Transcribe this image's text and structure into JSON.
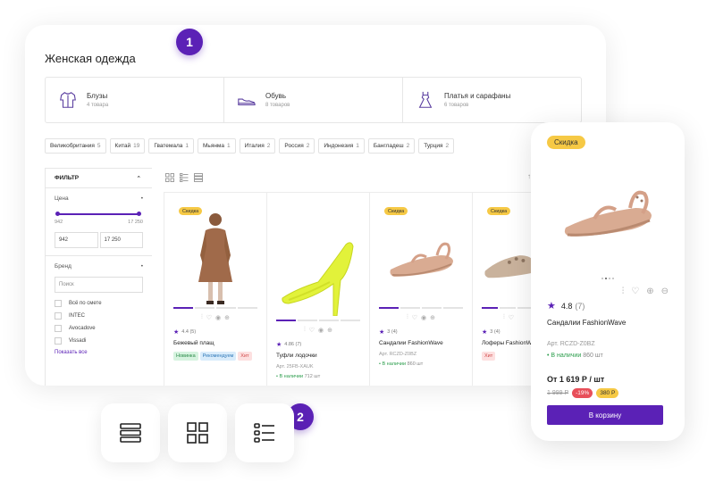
{
  "badges": {
    "first": "1",
    "second": "2"
  },
  "page": {
    "title": "Женская одежда"
  },
  "categories": [
    {
      "name": "Блузы",
      "count": "4 товара",
      "icon": "blouse-icon"
    },
    {
      "name": "Обувь",
      "count": "8 товаров",
      "icon": "shoe-icon"
    },
    {
      "name": "Платья и сарафаны",
      "count": "6 товаров",
      "icon": "dress-icon"
    }
  ],
  "countries": [
    {
      "name": "Великобритания",
      "count": "5"
    },
    {
      "name": "Китай",
      "count": "19"
    },
    {
      "name": "Гватемала",
      "count": "1"
    },
    {
      "name": "Мьянма",
      "count": "1"
    },
    {
      "name": "Италия",
      "count": "2"
    },
    {
      "name": "Россия",
      "count": "2"
    },
    {
      "name": "Индонезия",
      "count": "1"
    },
    {
      "name": "Бангладеш",
      "count": "2"
    },
    {
      "name": "Турция",
      "count": "2"
    }
  ],
  "filter": {
    "title": "ФИЛЬТР",
    "price_label": "Цена",
    "price_min": "942",
    "price_max": "17 250",
    "brand_label": "Бренд",
    "search_placeholder": "Поиск",
    "brands": [
      "Всё по смете",
      "INTEC",
      "Avocadove",
      "Vissadi"
    ],
    "show_all": "Показать все"
  },
  "products": [
    {
      "sale": "Скидка",
      "rating": "4.4 (5)",
      "name": "Бежевый плащ",
      "tags": [
        {
          "t": "Новинка",
          "c": "green"
        },
        {
          "t": "Рекомендуем",
          "c": "blue"
        },
        {
          "t": "Хит",
          "c": "pink"
        }
      ]
    },
    {
      "sale": "",
      "rating": "4.86 (7)",
      "name": "Туфли лодочки",
      "art": "Арт. 25FB-XAUK",
      "stock_label": "В наличии",
      "stock_count": "712 шт"
    },
    {
      "sale": "Скидка",
      "rating": "3 (4)",
      "name": "Сандалии FashionWave",
      "art": "Арт. RCZD-Z0BZ",
      "stock_label": "В наличии",
      "stock_count": "860 шт"
    },
    {
      "sale": "Скидка",
      "rating": "3 (4)",
      "name": "Лоферы FashionWave DETAIL LOAFERS",
      "tags": [
        {
          "t": "Хит",
          "c": "pink"
        }
      ]
    }
  ],
  "mobile": {
    "sale": "Скидка",
    "rating": "4.8",
    "rating_count": "(7)",
    "name": "Сандалии FashionWave",
    "art": "Арт. RCZD-Z0BZ",
    "stock_label": "В наличии",
    "stock_count": "860 шт",
    "price": "От 1 619 Р / шт",
    "old_price": "1 999 Р",
    "discount": "-19%",
    "bonus": "380 Р",
    "cart_button": "В корзину"
  },
  "colors": {
    "accent": "#5b21b6",
    "sale": "#f6c945",
    "discount": "#e84f5a",
    "stock": "#2a9d4b"
  }
}
